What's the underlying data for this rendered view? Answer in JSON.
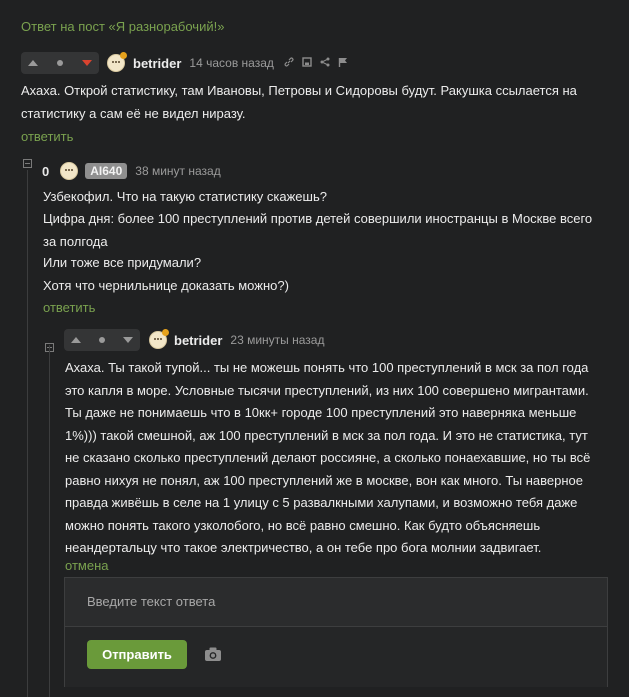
{
  "post_ref": "Ответ на пост «Я разнорабочий!»",
  "comment1": {
    "rating": "",
    "author": "betrider",
    "time": "14 часов назад",
    "text": "Ахаха. Открой статистику, там Ивановы, Петровы и Сидоровы будут. Ракушка ссылается на статистику а сам её не видел ниразу.",
    "reply_label": "ответить",
    "tools": [
      "link-icon",
      "save-icon",
      "share-icon",
      "flag-icon"
    ]
  },
  "comment2": {
    "rating": "0",
    "author": "AI640",
    "time": "38 минут назад",
    "line1": "Узбекофил. Что на такую статистику скажешь?",
    "link_text": "Цифра дня: более 100 преступлений против детей совершили иностранцы в Москве всего за полгода",
    "line3": "Или тоже все придумали?",
    "line4": "Хотя что чернильнице доказать можно?)",
    "reply_label": "ответить"
  },
  "comment3": {
    "author": "betrider",
    "time": "23 минуты назад",
    "text": "Ахаха. Ты такой тупой... ты не можешь понять что 100 преступлений в мск за пол года это капля в море. Условные тысячи преступлений, из них 100 совершено мигрантами. Ты даже не понимаешь что в 10кк+ городе 100 преступлений это наверняка меньше 1%))) такой смешной, аж 100 преступлений в мск за пол года. И это не статистика, тут не сказано сколько преступлений делают россияне, а сколько понаехавшие, но ты всё равно нихуя не понял, аж 100 преступлений же в москве, вон как много. Ты наверное правда живёшь в селе на 1 улицу с 5 развалкными халупами, и возможно тебя даже можно понять такого узколобого, но всё равно смешно. Как будто объясняешь неандертальцу что такое электричество, а он тебе про бога молнии задвигает.",
    "cancel_label": "отмена"
  },
  "reply_box": {
    "placeholder": "Введите текст ответа",
    "send_label": "Отправить",
    "camera_icon": "camera-icon"
  },
  "colors": {
    "background": "#202122",
    "link_green": "#7aa24f",
    "downvote_red": "#d9432f",
    "send_button": "#6a9a3a"
  }
}
